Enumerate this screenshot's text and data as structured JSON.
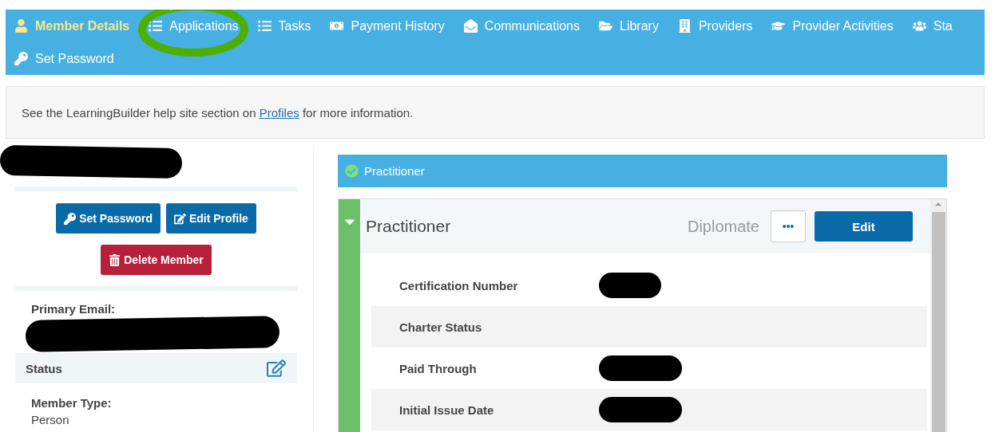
{
  "nav_rows": [
    [
      {
        "label": "Member Details",
        "selected": true,
        "highlighted": false
      },
      {
        "label": "Applications",
        "selected": false,
        "highlighted": true
      },
      {
        "label": "Tasks",
        "selected": false,
        "highlighted": false
      },
      {
        "label": "Payment History",
        "selected": false,
        "highlighted": false
      },
      {
        "label": "Communications",
        "selected": false,
        "highlighted": false
      },
      {
        "label": "Library",
        "selected": false,
        "highlighted": false
      },
      {
        "label": "Providers",
        "selected": false,
        "highlighted": false
      },
      {
        "label": "Provider Activities",
        "selected": false,
        "highlighted": false
      },
      {
        "label": "Sta",
        "selected": false,
        "highlighted": false
      }
    ],
    [
      {
        "label": "Set Password",
        "selected": false,
        "highlighted": false
      }
    ]
  ],
  "help": {
    "before": "See the LearningBuilder help site section on",
    "link": "Profiles",
    "after": "for more information."
  },
  "member": {
    "name_redacted": true,
    "buttons": [
      {
        "label": "Set Password",
        "kind": "primary"
      },
      {
        "label": "Edit Profile",
        "kind": "primary"
      },
      {
        "label": "Delete Member",
        "kind": "danger"
      }
    ],
    "primary_email": {
      "label": "Primary Email:",
      "redacted": true
    },
    "status": {
      "title": "Status",
      "fields": [
        {
          "label": "Member Type:",
          "value": "Person"
        }
      ]
    }
  },
  "credential": {
    "banner": "Practitioner",
    "card": {
      "title": "Practitioner",
      "expanded": true,
      "level_label": "Diplomate",
      "edit": "Edit",
      "rows": [
        {
          "label": "Certification Number",
          "redacted": true
        },
        {
          "label": "Charter Status",
          "redacted": false
        },
        {
          "label": "Paid Through",
          "redacted": true
        },
        {
          "label": "Initial Issue Date",
          "redacted": true
        }
      ]
    }
  }
}
